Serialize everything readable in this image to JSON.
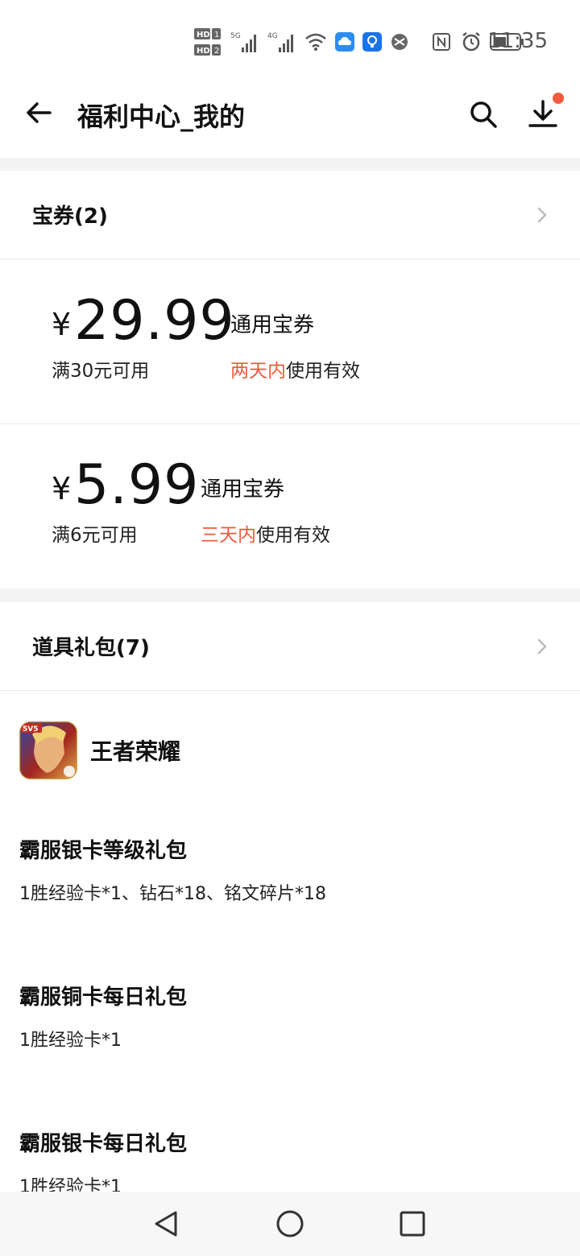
{
  "status_bar": {
    "time": "11:35",
    "icons": [
      "hd-icon",
      "signal-5g-icon",
      "signal-4g-icon",
      "wifi-icon",
      "cloud-icon",
      "bulb-icon",
      "vpn-icon",
      "nfc-icon",
      "alarm-icon",
      "battery-icon"
    ]
  },
  "header": {
    "title": "福利中心_我的"
  },
  "coupons_section": {
    "label": "宝券(2)",
    "items": [
      {
        "currency": "¥",
        "amount": "29.99",
        "condition": "满30元可用",
        "type": "通用宝券",
        "valid_highlight": "两天内",
        "valid_rest": "使用有效"
      },
      {
        "currency": "¥",
        "amount": "5.99",
        "condition": "满6元可用",
        "type": "通用宝券",
        "valid_highlight": "三天内",
        "valid_rest": "使用有效"
      }
    ]
  },
  "gifts_section": {
    "label": "道具礼包(7)",
    "game_name": "王者荣耀",
    "items": [
      {
        "title": "霸服银卡等级礼包",
        "desc": "1胜经验卡*1、钻石*18、铭文碎片*18"
      },
      {
        "title": "霸服铜卡每日礼包",
        "desc": "1胜经验卡*1"
      },
      {
        "title": "霸服银卡每日礼包",
        "desc": "1胜经验卡*1"
      }
    ]
  },
  "colors": {
    "accent": "#ee5a3b",
    "badge": "#f25b3d",
    "divider_bg": "#f4f4f4"
  }
}
